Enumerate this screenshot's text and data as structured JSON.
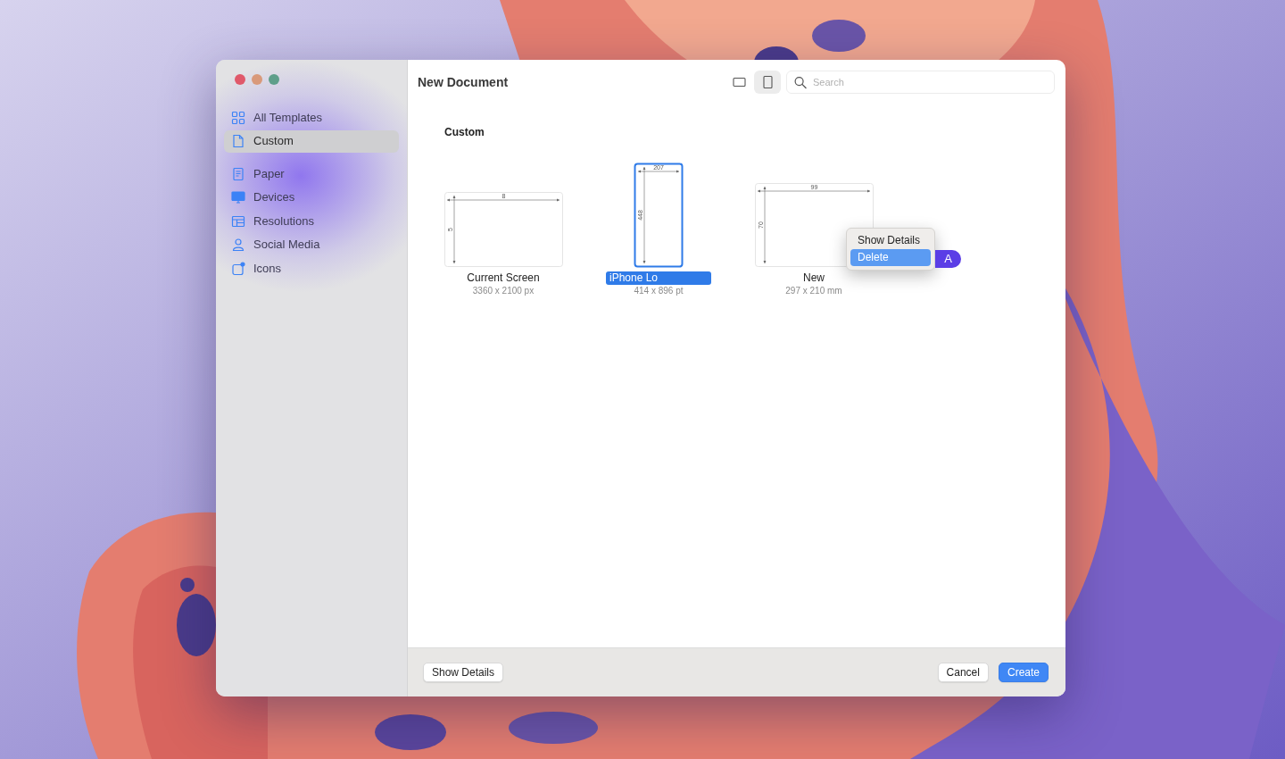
{
  "window": {
    "title": "New Document"
  },
  "traffic_lights": [
    {
      "color": "#e0596a"
    },
    {
      "color": "#d99a7a"
    },
    {
      "color": "#5f9f8a"
    }
  ],
  "sidebar": {
    "items": [
      {
        "label": "All Templates",
        "selected": false
      },
      {
        "label": "Custom",
        "selected": true
      },
      {
        "label": "Paper",
        "selected": false
      },
      {
        "label": "Devices",
        "selected": false
      },
      {
        "label": "Resolutions",
        "selected": false
      },
      {
        "label": "Social Media",
        "selected": false
      },
      {
        "label": "Icons",
        "selected": false
      }
    ]
  },
  "view_toggle": [
    {
      "selected": false
    },
    {
      "selected": true
    }
  ],
  "search": {
    "placeholder": "Search"
  },
  "section": {
    "title": "Custom"
  },
  "templates": [
    {
      "kind": "landscape",
      "name": "Current Screen",
      "size": "3360 x 2100 px",
      "width_label": "8",
      "height_label": "5",
      "selected": false
    },
    {
      "kind": "portrait",
      "name": "iPhone Lo",
      "size": "414 x 896 pt",
      "width_label": "207",
      "height_label": "448",
      "selected": true
    },
    {
      "kind": "paper",
      "name": "New",
      "size": "297 x 210 mm",
      "width_label": "99",
      "height_label": "70",
      "selected": false
    }
  ],
  "context_menu": {
    "items": [
      {
        "label": "Show Details",
        "selected": false
      },
      {
        "label": "Delete",
        "selected": true
      }
    ]
  },
  "cursor_badge": "A",
  "footer": {
    "details_button": "Show Details",
    "cancel_button": "Cancel",
    "create_button": "Create"
  }
}
